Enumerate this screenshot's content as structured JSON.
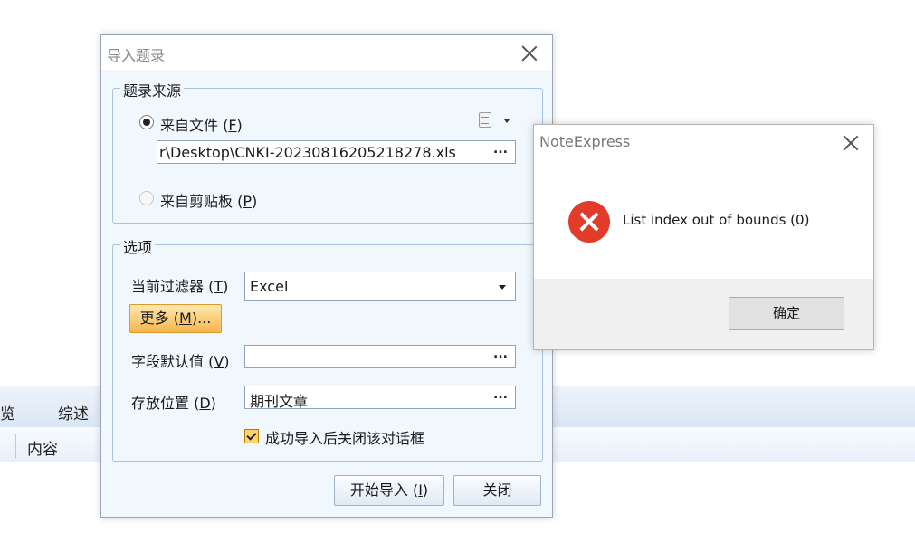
{
  "background": {
    "tabs": [
      "览",
      "综述"
    ],
    "columns": [
      "内容"
    ]
  },
  "import_dialog": {
    "title": "导入题录",
    "source_group": {
      "label": "题录来源",
      "from_file": {
        "label": "来自文件",
        "accel": "F",
        "selected": true
      },
      "file_path": "r\\Desktop\\CNKI-20230816205218278.xls",
      "browse": "...",
      "from_clipboard": {
        "label": "来自剪贴板",
        "accel": "P",
        "selected": false
      }
    },
    "options_group": {
      "label": "选项",
      "filter": {
        "label": "当前过滤器",
        "accel": "T",
        "value": "Excel"
      },
      "more_button": {
        "label": "更多",
        "accel": "M",
        "suffix": "..."
      },
      "default_values": {
        "label": "字段默认值",
        "accel": "V",
        "value": "",
        "browse": "..."
      },
      "location": {
        "label": "存放位置",
        "accel": "D",
        "value": "期刊文章",
        "browse": "..."
      },
      "close_after": {
        "label": "成功导入后关闭该对话框",
        "checked": true
      }
    },
    "start_button": {
      "label": "开始导入",
      "accel": "I"
    },
    "close_button": "关闭"
  },
  "message_box": {
    "title": "NoteExpress",
    "icon": "error-icon",
    "message": "List index out of bounds (0)",
    "ok_button": "确定"
  }
}
